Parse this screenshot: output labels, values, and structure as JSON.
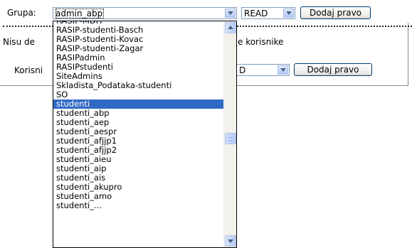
{
  "row1": {
    "grupa_label": "Grupa:",
    "grupa_value": "admin_abp",
    "permission_value": "READ",
    "add_button": "Dodaj pravo"
  },
  "row2": {
    "text_left": "Nisu de",
    "text_right": "e korisnike"
  },
  "row3": {
    "korisnik_label": "Korisni",
    "permission_value_fragment": "D",
    "add_button": "Dodaj pravo"
  },
  "dropdown": {
    "items": [
      "RASIP-MDH",
      "RASIP-studenti-Basch",
      "RASIP-studenti-Kovac",
      "RASIP-studenti-Zagar",
      "RASIPadmin",
      "RASIPstudenti",
      "SiteAdmins",
      "Skladista_Podataka-studenti",
      "SO",
      "studenti",
      "studenti_abp",
      "studenti_aep",
      "studenti_aespr",
      "studenti_afjjp1",
      "studenti_afjjp2",
      "studenti_aieu",
      "studenti_aip",
      "studenti_ais",
      "studenti_akupro",
      "studenti_amo",
      "studenti_..."
    ],
    "selected_index": 9
  },
  "icons": {
    "select_arrow": "chevron-down-icon",
    "scroll_up": "scroll-up-icon",
    "scroll_down": "scroll-down-icon"
  }
}
